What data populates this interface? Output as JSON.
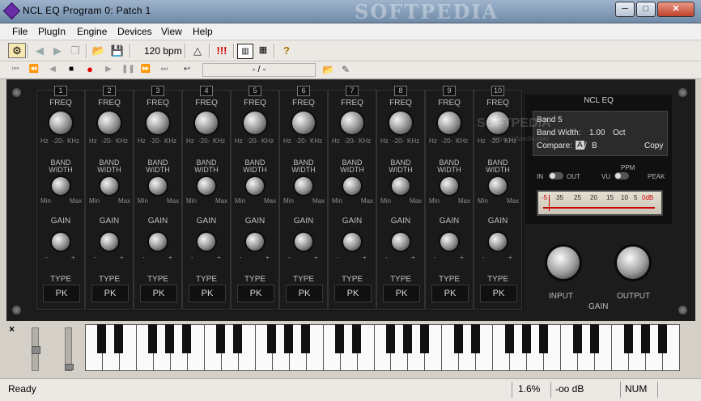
{
  "window": {
    "title": "NCL EQ Program 0: Patch   1",
    "watermark": "SOFTPEDIA",
    "minimize_label": "─",
    "maximize_label": "□",
    "close_label": "✕"
  },
  "menu": [
    "File",
    "PlugIn",
    "Engine",
    "Devices",
    "View",
    "Help"
  ],
  "toolbar": {
    "tempo": "120 bpm",
    "position": "- / -"
  },
  "plugin": {
    "bands": [
      {
        "num": "1",
        "type": "PK"
      },
      {
        "num": "2",
        "type": "PK"
      },
      {
        "num": "3",
        "type": "PK"
      },
      {
        "num": "4",
        "type": "PK"
      },
      {
        "num": "5",
        "type": "PK"
      },
      {
        "num": "6",
        "type": "PK"
      },
      {
        "num": "7",
        "type": "PK"
      },
      {
        "num": "8",
        "type": "PK"
      },
      {
        "num": "9",
        "type": "PK"
      },
      {
        "num": "10",
        "type": "PK"
      }
    ],
    "labels": {
      "freq": "FREQ",
      "freq_low": "Hz",
      "freq_mid": "-20-",
      "freq_high": "KHz",
      "band_width_1": "BAND",
      "band_width_2": "WIDTH",
      "bw_min": "Min",
      "bw_max": "Max",
      "gain": "GAIN",
      "gain_minus": "-",
      "gain_plus": "+",
      "type": "TYPE"
    },
    "panel": {
      "title": "NCL EQ",
      "band": "Band 5",
      "band_width_label": "Band Width:",
      "band_width_value": "1.00",
      "band_width_unit": "Oct",
      "compare_label": "Compare:",
      "compare_a": "A",
      "compare_sep": "/",
      "compare_b": "B",
      "copy": "Copy",
      "watermark": "SOFTPEDIA",
      "watermark_url": "www.softpedia.com",
      "in": "IN",
      "out": "OUT",
      "ppm": "PPM",
      "vu": "VU",
      "peak": "PEAK",
      "vu_scale": [
        "-5",
        "35",
        "25",
        "20",
        "15",
        "10",
        "5",
        "0dB"
      ],
      "input": "INPUT",
      "output": "OUTPUT",
      "gain": "GAIN"
    }
  },
  "keyboard": {
    "close": "×"
  },
  "status": {
    "text": "Ready",
    "cpu": "1.6%",
    "level": "-oo dB",
    "num": "NUM"
  }
}
